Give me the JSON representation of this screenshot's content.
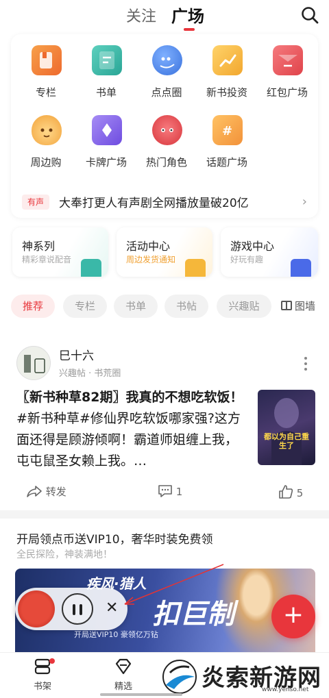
{
  "header": {
    "tabs": [
      {
        "label": "关注",
        "active": false
      },
      {
        "label": "广场",
        "active": true
      }
    ],
    "search_icon": "search-icon"
  },
  "features": [
    {
      "label": "专栏",
      "icon": "column-icon",
      "color": "#f28a3c"
    },
    {
      "label": "书单",
      "icon": "booklist-icon",
      "color": "#3ab8a8"
    },
    {
      "label": "点点圈",
      "icon": "chat-circle-icon",
      "color": "#4a86e8"
    },
    {
      "label": "新书投资",
      "icon": "invest-icon",
      "color": "#f5b73a"
    },
    {
      "label": "红包广场",
      "icon": "red-packet-icon",
      "color": "#e8545a"
    },
    {
      "label": "周边购",
      "icon": "fox-icon",
      "color": "#f5b24a"
    },
    {
      "label": "卡牌广场",
      "icon": "card-icon",
      "color": "#8a6ae8"
    },
    {
      "label": "热门角色",
      "icon": "character-icon",
      "color": "#e8545a"
    },
    {
      "label": "话题广场",
      "icon": "hashtag-icon",
      "color": "#f5a03a"
    }
  ],
  "news": {
    "tag": "有声",
    "text": "大奉打更人有声剧全网播放量破20亿",
    "arrow": "›"
  },
  "mini_cards": [
    {
      "title": "神系列",
      "subtitle": "精彩章说配音",
      "accent": "#3ab8a8"
    },
    {
      "title": "活动中心",
      "subtitle": "周边发货通知",
      "accent": "#f5b73a"
    },
    {
      "title": "游戏中心",
      "subtitle": "好玩有趣",
      "accent": "#4a6ae8"
    }
  ],
  "chips": [
    {
      "label": "推荐",
      "active": true
    },
    {
      "label": "专栏",
      "active": false
    },
    {
      "label": "书单",
      "active": false
    },
    {
      "label": "书帖",
      "active": false
    },
    {
      "label": "兴趣贴",
      "active": false
    }
  ],
  "view_toggle": "图墙",
  "post": {
    "author": "巳十六",
    "meta": "兴趣帖 · 书荒圈",
    "title": "〖新书种草82期〗我真的不想吃软饭！",
    "body": "#新书种草#修仙界吃软饭哪家强?这方面还得是顾游倾啊！霸道师姐缠上我，屯屯鼠圣女赖上我。…",
    "thumb_text": "都以为自己重生了",
    "share": "转发",
    "comments": "1",
    "likes": "5"
  },
  "post2": {
    "title": "开局领点币送VIP10，奢华时装免费领",
    "subtitle": "全民探险，神装满地！",
    "banner_title": "疾风·猎人",
    "banner_big": "扣巨制",
    "banner_small": "开局送VIP10 豪领亿万钻"
  },
  "bottom_nav": [
    {
      "label": "书架",
      "icon": "bookshelf-icon"
    },
    {
      "label": "精选",
      "icon": "diamond-icon"
    }
  ],
  "watermark": {
    "text": "炎索新游网",
    "url": "www.yenso.net"
  },
  "colors": {
    "accent": "#e8363c"
  }
}
